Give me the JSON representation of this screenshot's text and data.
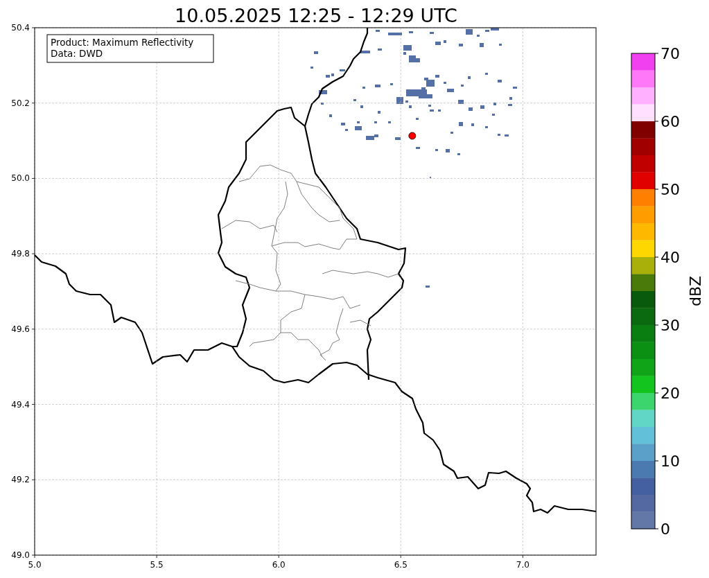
{
  "title": "10.05.2025 12:25 - 12:29 UTC",
  "annotation": [
    "Product: Maximum Reflectivity",
    "Data: DWD"
  ],
  "chart_data": {
    "type": "scatter",
    "xlim": [
      5.0,
      7.3
    ],
    "ylim": [
      49.0,
      50.4
    ],
    "grid": true,
    "xticks": [
      {
        "value": 5.0,
        "label": "5.0"
      },
      {
        "value": 5.5,
        "label": "5.5"
      },
      {
        "value": 6.0,
        "label": "6.0"
      },
      {
        "value": 6.5,
        "label": "6.5"
      },
      {
        "value": 7.0,
        "label": "7.0"
      }
    ],
    "yticks": [
      {
        "value": 49.0,
        "label": "49.0"
      },
      {
        "value": 49.2,
        "label": "49.2"
      },
      {
        "value": 49.4,
        "label": "49.4"
      },
      {
        "value": 49.6,
        "label": "49.6"
      },
      {
        "value": 49.8,
        "label": "49.8"
      },
      {
        "value": 50.0,
        "label": "50.0"
      },
      {
        "value": 50.2,
        "label": "50.2"
      },
      {
        "value": 50.4,
        "label": "50.4"
      }
    ],
    "x": [
      6.547
    ],
    "series": [
      {
        "color": "#ff0000",
        "values": [
          50.113
        ]
      }
    ]
  },
  "colorbar": {
    "label": "dBZ",
    "ticks": [
      "70",
      "60",
      "50",
      "40",
      "30",
      "20",
      "10",
      "0"
    ],
    "bins": [
      {
        "color": "#f040f0"
      },
      {
        "color": "#ff78f8"
      },
      {
        "color": "#ffb0ff"
      },
      {
        "color": "#ffe0ff"
      },
      {
        "color": "#800000"
      },
      {
        "color": "#a00000"
      },
      {
        "color": "#c00000"
      },
      {
        "color": "#e00000"
      },
      {
        "color": "#ff8000"
      },
      {
        "color": "#ff9c00"
      },
      {
        "color": "#ffb800"
      },
      {
        "color": "#ffd700"
      },
      {
        "color": "#aab00a"
      },
      {
        "color": "#4a7a0a"
      },
      {
        "color": "#0a5a0e"
      },
      {
        "color": "#0b6a10"
      },
      {
        "color": "#0b7e12"
      },
      {
        "color": "#0b9014"
      },
      {
        "color": "#10a418"
      },
      {
        "color": "#14c41e"
      },
      {
        "color": "#3cd46c"
      },
      {
        "color": "#62d6c6"
      },
      {
        "color": "#62c0d8"
      },
      {
        "color": "#5aa0c8"
      },
      {
        "color": "#4a7ab0"
      },
      {
        "color": "#4460a0"
      },
      {
        "color": "#5468a2"
      },
      {
        "color": "#6478a8"
      }
    ]
  }
}
